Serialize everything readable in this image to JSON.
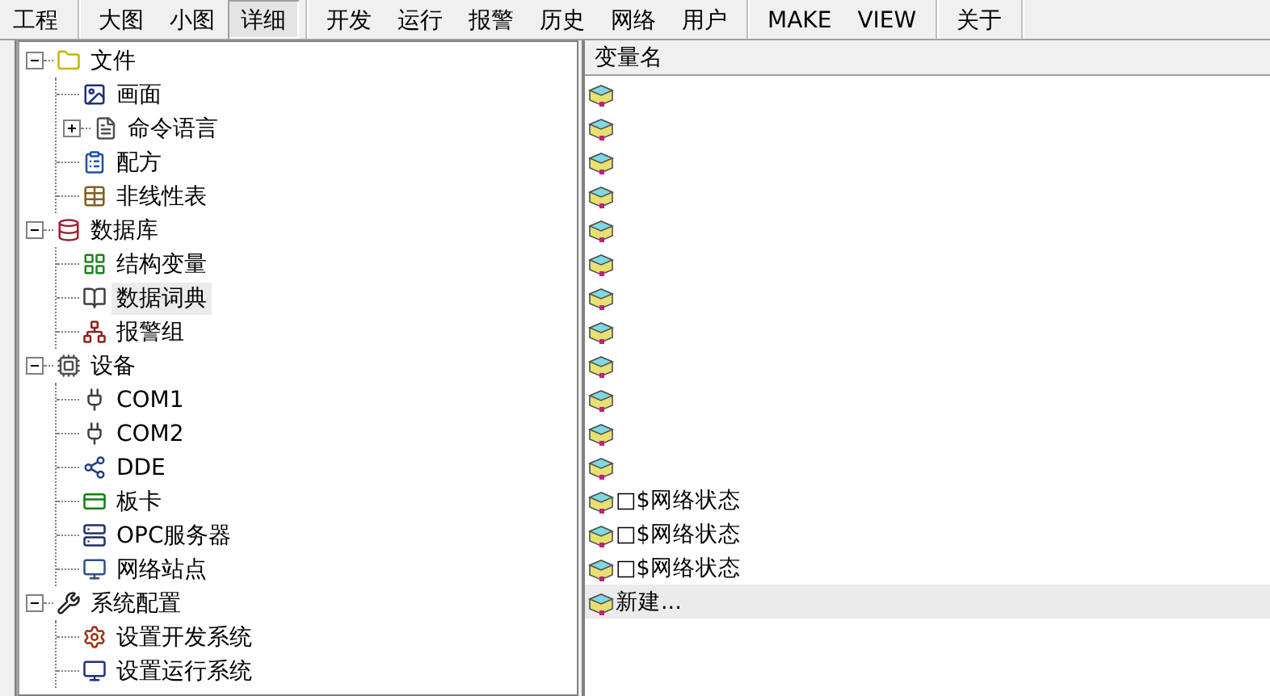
{
  "toolbar": {
    "groups": [
      {
        "buttons": [
          {
            "label": "工程",
            "selected": false
          }
        ]
      },
      {
        "buttons": [
          {
            "label": "大图",
            "selected": false
          },
          {
            "label": "小图",
            "selected": false
          },
          {
            "label": "详细",
            "selected": true
          }
        ]
      },
      {
        "buttons": [
          {
            "label": "开发",
            "selected": false
          },
          {
            "label": "运行",
            "selected": false
          },
          {
            "label": "报警",
            "selected": false
          },
          {
            "label": "历史",
            "selected": false
          },
          {
            "label": "网络",
            "selected": false
          },
          {
            "label": "用户",
            "selected": false
          }
        ]
      },
      {
        "buttons": [
          {
            "label": "MAKE",
            "selected": false
          },
          {
            "label": "VIEW",
            "selected": false
          }
        ]
      },
      {
        "buttons": [
          {
            "label": "关于",
            "selected": false
          }
        ]
      }
    ]
  },
  "tree": {
    "items": [
      {
        "label": "文件",
        "kind": "folder",
        "expanded": true,
        "selected": false,
        "children": [
          {
            "label": "画面",
            "kind": "screen",
            "selected": false
          },
          {
            "label": "命令语言",
            "kind": "script",
            "expanded": false,
            "selected": false
          },
          {
            "label": "配方",
            "kind": "recipe",
            "selected": false
          },
          {
            "label": "非线性表",
            "kind": "table",
            "selected": false
          }
        ]
      },
      {
        "label": "数据库",
        "kind": "database",
        "expanded": true,
        "selected": false,
        "children": [
          {
            "label": "结构变量",
            "kind": "struct",
            "selected": false
          },
          {
            "label": "数据词典",
            "kind": "dictionary",
            "selected": true
          },
          {
            "label": "报警组",
            "kind": "alarm",
            "selected": false
          }
        ]
      },
      {
        "label": "设备",
        "kind": "devices",
        "expanded": true,
        "selected": false,
        "children": [
          {
            "label": "COM1",
            "kind": "port",
            "selected": false
          },
          {
            "label": "COM2",
            "kind": "port",
            "selected": false
          },
          {
            "label": "DDE",
            "kind": "dde",
            "selected": false
          },
          {
            "label": "板卡",
            "kind": "card",
            "selected": false
          },
          {
            "label": "OPC服务器",
            "kind": "opc",
            "selected": false
          },
          {
            "label": "网络站点",
            "kind": "network",
            "selected": false
          }
        ]
      },
      {
        "label": "系统配置",
        "kind": "tools",
        "expanded": true,
        "selected": false,
        "children": [
          {
            "label": "设置开发系统",
            "kind": "settings",
            "selected": false
          },
          {
            "label": "设置运行系统",
            "kind": "monitor",
            "selected": false
          }
        ]
      }
    ]
  },
  "variables": {
    "column": "变量名",
    "rows": [
      {
        "name": "",
        "selected": false
      },
      {
        "name": "",
        "selected": false
      },
      {
        "name": "",
        "selected": false
      },
      {
        "name": "",
        "selected": false
      },
      {
        "name": "",
        "selected": false
      },
      {
        "name": "",
        "selected": false
      },
      {
        "name": "",
        "selected": false
      },
      {
        "name": "",
        "selected": false
      },
      {
        "name": "",
        "selected": false
      },
      {
        "name": "",
        "selected": false
      },
      {
        "name": "",
        "selected": false
      },
      {
        "name": "",
        "selected": false
      },
      {
        "name": "□$网络状态",
        "selected": false
      },
      {
        "name": "□$网络状态",
        "selected": false
      },
      {
        "name": "□$网络状态",
        "selected": false
      },
      {
        "name": "新建...",
        "selected": true
      }
    ]
  }
}
